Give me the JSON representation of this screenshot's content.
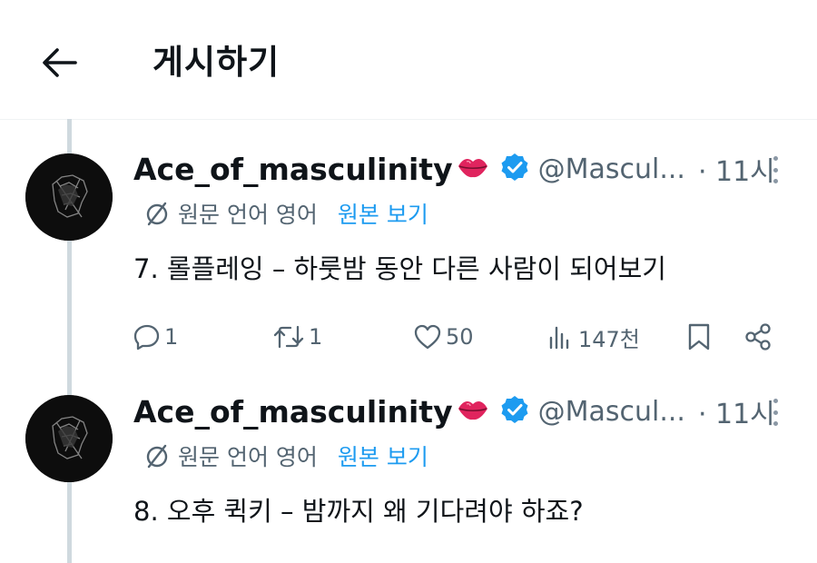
{
  "header": {
    "title": "게시하기"
  },
  "tweets": [
    {
      "author": "Ace_of_masculinity",
      "handle": "@Mascul...",
      "time": "· 11시",
      "translate_info": "원문 언어 영어",
      "show_original": "원본 보기",
      "text": "7. 롤플레잉 – 하룻밤 동안 다른 사람이 되어보기",
      "actions": {
        "replies": "1",
        "reposts": "1",
        "likes": "50",
        "views": "147천"
      }
    },
    {
      "author": "Ace_of_masculinity",
      "handle": "@Mascul...",
      "time": "· 11시",
      "translate_info": "원문 언어 영어",
      "show_original": "원본 보기",
      "text": "8. 오후 퀵키 – 밤까지 왜 기다려야 하죠?"
    }
  ],
  "colors": {
    "accent": "#1d9bf0",
    "text": "#0f1419",
    "muted": "#536471",
    "lips": "#e0245e"
  }
}
